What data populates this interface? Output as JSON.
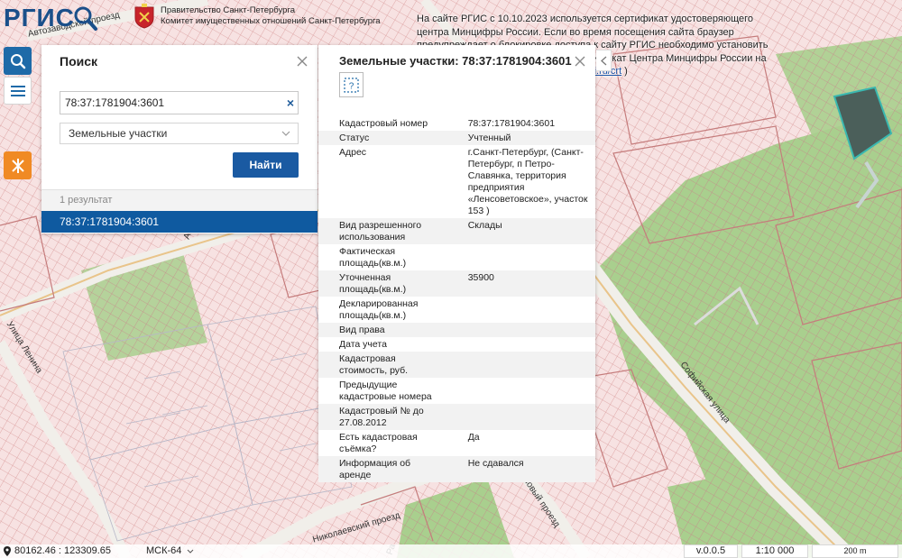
{
  "header": {
    "logo_text": "РГИС",
    "gov_line1": "Правительство Санкт-Петербурга",
    "gov_line2": "Комитет имущественных отношений Санкт-Петербурга"
  },
  "cert_note": {
    "text": "На сайте РГИС с 10.10.2023 используется сертификат удостоверяющего центра Минцифры России. Если во время посещения сайта браузер предупреждает о блокировке доступа к сайту РГИС необходимо установить отечественные сертификаты или сертификат Центра Минцифры России на ваше устройство (",
    "link": "https://www.gosuslugi.ru/crt",
    "suffix": " )"
  },
  "tools": {
    "search_icon": "search-icon",
    "menu_icon": "menu-icon",
    "layers_icon": "layers-icon"
  },
  "search_panel": {
    "title": "Поиск",
    "query": "78:37:1781904:3601",
    "layer": "Земельные участки",
    "find_label": "Найти",
    "results_count": "1 результат",
    "result": "78:37:1781904:3601"
  },
  "info_panel": {
    "title": "Земельные участки: 78:37:1781904:3601",
    "rows": [
      {
        "k": "Кадастровый номер",
        "v": "78:37:1781904:3601"
      },
      {
        "k": "Статус",
        "v": "Учтенный"
      },
      {
        "k": "Адрес",
        "v": "г.Санкт-Петербург, (Санкт-Петербург, п Петро-Славянка, территория предприятия «Ленсоветовское», участок 153 )"
      },
      {
        "k": "Вид разрешенного использования",
        "v": "Склады"
      },
      {
        "k": "Фактическая площадь(кв.м.)",
        "v": ""
      },
      {
        "k": "Уточненная площадь(кв.м.)",
        "v": "35900"
      },
      {
        "k": "Декларированная площадь(кв.м.)",
        "v": ""
      },
      {
        "k": "Вид права",
        "v": ""
      },
      {
        "k": "Дата учета",
        "v": ""
      },
      {
        "k": "Кадастровая стоимость, руб.",
        "v": ""
      },
      {
        "k": "Предыдущие кадастровые номера",
        "v": ""
      },
      {
        "k": "Кадастровый № до 27.08.2012",
        "v": ""
      },
      {
        "k": "Есть кадастровая съёмка?",
        "v": "Да"
      },
      {
        "k": "Информация об аренде",
        "v": "Не сдавался"
      }
    ]
  },
  "map": {
    "streets": [
      "Автозаводской проезд",
      "Софийская улица",
      "Николаевский проезд",
      "Крановый проезд",
      "Улица Ленина",
      "Ав",
      "Ра"
    ]
  },
  "bottom_bar": {
    "coords": "80162.46 : 123309.65",
    "crs": "МСК-64",
    "version": "v.0.0.5",
    "scale": "1:10 000",
    "scalebar": "200 m"
  },
  "colors": {
    "accent": "#1a5aa2",
    "result_highlight": "#0f5aa0",
    "parcel_fill": "#f6dede",
    "parcel_hatch": "#e0a0a0",
    "green_zone": "#a8cf8c",
    "selected_parcel": "#3a7a76"
  }
}
